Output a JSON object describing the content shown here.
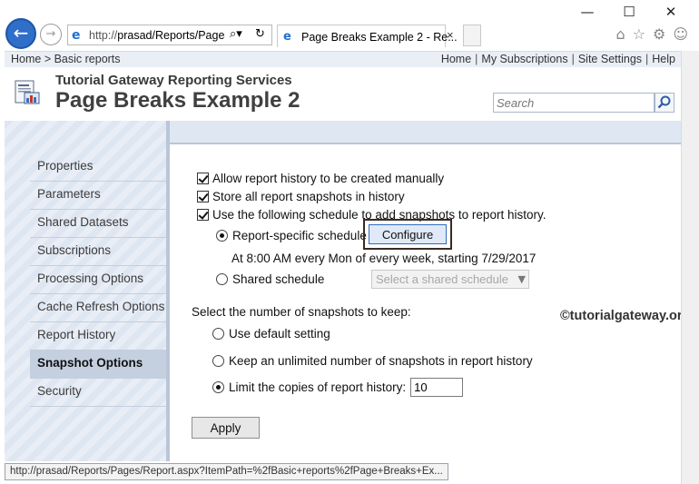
{
  "browser": {
    "address_prefix": "http://",
    "address_host_path": "prasad/Reports/Pages",
    "tab_title": "Page Breaks Example 2 - Re...",
    "status_url": "http://prasad/Reports/Pages/Report.aspx?ItemPath=%2fBasic+reports%2fPage+Breaks+Ex..."
  },
  "topbar": {
    "breadcrumb": "Home > Basic reports",
    "links": [
      "Home",
      "My Subscriptions",
      "Site Settings",
      "Help"
    ]
  },
  "header": {
    "site_title": "Tutorial Gateway Reporting Services",
    "page_title": "Page Breaks Example 2",
    "search_placeholder": "Search"
  },
  "sidebar": {
    "items": [
      {
        "label": "Properties",
        "active": false
      },
      {
        "label": "Parameters",
        "active": false
      },
      {
        "label": "Shared Datasets",
        "active": false
      },
      {
        "label": "Subscriptions",
        "active": false
      },
      {
        "label": "Processing Options",
        "active": false
      },
      {
        "label": "Cache Refresh Options",
        "active": false
      },
      {
        "label": "Report History",
        "active": false
      },
      {
        "label": "Snapshot Options",
        "active": true
      },
      {
        "label": "Security",
        "active": false
      }
    ]
  },
  "snapshot": {
    "allow_history_label": "Allow report history to be created manually",
    "store_snapshots_label": "Store all report snapshots in history",
    "use_schedule_label": "Use the following schedule to add snapshots to report history.",
    "report_specific_label": "Report-specific schedule",
    "configure_label": "Configure",
    "schedule_description": "At 8:00 AM every Mon of every week, starting 7/29/2017",
    "shared_schedule_label": "Shared schedule",
    "shared_schedule_select": "Select a shared schedule",
    "keep_heading": "Select the number of snapshots to keep:",
    "use_default_label": "Use default setting",
    "keep_unlimited_label": "Keep an unlimited number of snapshots in report history",
    "limit_copies_label": "Limit the copies of report history:",
    "limit_copies_value": "10",
    "apply_label": "Apply"
  },
  "watermark": "©tutorialgateway.org"
}
